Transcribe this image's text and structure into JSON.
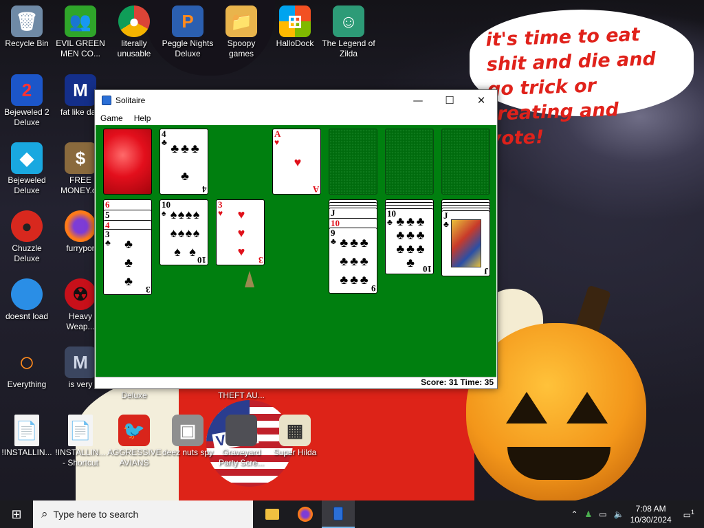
{
  "wallpaper": {
    "bubble_text": "it's time to eat shit and die and go trick or treating and vote!",
    "vote_label": "VOTE"
  },
  "desktop_icons": [
    {
      "name": "recycle-bin",
      "label": "Recycle Bin",
      "glyph": "🗑"
    },
    {
      "name": "evil-green-men",
      "label": "EVIL GREEN MEN CO...",
      "glyph": "👥"
    },
    {
      "name": "literally-unusable",
      "label": "literally unusable",
      "glyph": "●"
    },
    {
      "name": "peggle-nights",
      "label": "Peggle Nights Deluxe",
      "glyph": "P"
    },
    {
      "name": "spoopy-games",
      "label": "Spoopy games",
      "glyph": "📁"
    },
    {
      "name": "hallodock",
      "label": "HalloDock",
      "glyph": "⊞"
    },
    {
      "name": "legend-of-zilda",
      "label": "The Legend of Zilda",
      "glyph": "☺"
    },
    {
      "name": "bejeweled-2",
      "label": "Bejeweled 2 Deluxe",
      "glyph": "2"
    },
    {
      "name": "fat-like-darl",
      "label": "fat like darl",
      "glyph": "M"
    },
    {
      "name": "bejeweled-deluxe",
      "label": "Bejeweled Deluxe",
      "glyph": "◆"
    },
    {
      "name": "free-money",
      "label": "FREE MONEY.cc",
      "glyph": "$"
    },
    {
      "name": "chuzzle-deluxe",
      "label": "Chuzzle Deluxe",
      "glyph": "●"
    },
    {
      "name": "furryporn",
      "label": "furrypor",
      "glyph": "●"
    },
    {
      "name": "doesnt-load",
      "label": "doesnt load",
      "glyph": "●"
    },
    {
      "name": "heavy-weapon",
      "label": "Heavy Weap...",
      "glyph": "☢"
    },
    {
      "name": "everything",
      "label": "Everything",
      "glyph": "○"
    },
    {
      "name": "is-very",
      "label": "is very",
      "glyph": "M"
    },
    {
      "name": "deluxe-partial",
      "label": "Deluxe",
      "glyph": ""
    },
    {
      "name": "theft-auto",
      "label": "THEFT AU...",
      "glyph": ""
    },
    {
      "name": "installing",
      "label": "!INSTALLIN...",
      "glyph": "📄"
    },
    {
      "name": "installing-shortcut",
      "label": "!INSTALLIN... - Shortcut",
      "glyph": "📄"
    },
    {
      "name": "aggressive-avians",
      "label": "AGGRESSIVE AVIANS",
      "glyph": "🐦"
    },
    {
      "name": "deez-nuts-spy",
      "label": "deez nuts spy",
      "glyph": "▣"
    },
    {
      "name": "graveyard-party",
      "label": "Graveyard Party Scre...",
      "glyph": ""
    },
    {
      "name": "super-hilda",
      "label": "Super Hilda",
      "glyph": "▦"
    }
  ],
  "window": {
    "title": "Solitaire",
    "menu": [
      "Game",
      "Help"
    ],
    "minimize": "—",
    "maximize": "☐",
    "close": "✕",
    "status": "Score: 31 Time: 35"
  },
  "cards": {
    "waste_top": {
      "rank": "4",
      "suit": "♣"
    },
    "foundation_1": {
      "rank": "A",
      "suit": "♥"
    },
    "t1_stack": [
      "6",
      "5",
      "4"
    ],
    "t1_top": {
      "rank": "3",
      "suit": "♣"
    },
    "t2_top": {
      "rank": "10",
      "suit": "♠"
    },
    "t3_top": {
      "rank": "3",
      "suit": "♥"
    },
    "t5_stack": [
      "J",
      "10"
    ],
    "t5_top": {
      "rank": "9",
      "suit": "♣"
    },
    "t6_top": {
      "rank": "10",
      "suit": "♣"
    },
    "t7_top": {
      "rank": "J",
      "suit": "♣"
    }
  },
  "taskbar": {
    "start": "⊞",
    "search_placeholder": "Type here to search",
    "search_icon": "⌕",
    "time": "7:08 AM",
    "date": "10/30/2024",
    "notification_count": "1"
  }
}
